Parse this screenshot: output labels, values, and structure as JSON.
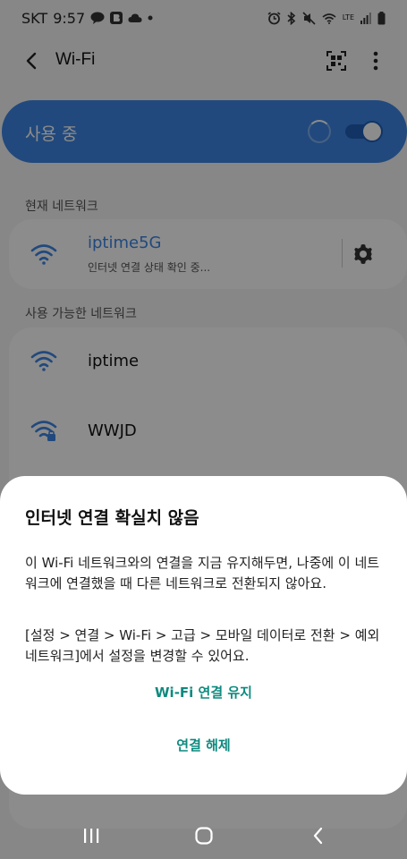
{
  "status_bar": {
    "carrier": "SKT",
    "time": "9:57",
    "network_type": "LTE",
    "icons": [
      "talk-icon",
      "b-app-icon",
      "cloud-icon",
      "dot-icon",
      "alarm-icon",
      "bluetooth-icon",
      "mute-icon",
      "wifi-status-icon",
      "signal-icon",
      "battery-icon"
    ]
  },
  "app_bar": {
    "title": "Wi-Fi",
    "icons": [
      "back-icon",
      "qr-scan-icon",
      "more-options-icon"
    ]
  },
  "wifi_toggle": {
    "label": "사용 중",
    "enabled": true
  },
  "current_network": {
    "section_label": "현재 네트워크",
    "name": "iptime5G",
    "status": "인터넷 연결 상태 확인 중..."
  },
  "available_networks": {
    "section_label": "사용 가능한 네트워크",
    "items": [
      {
        "name": "iptime",
        "secured": false
      },
      {
        "name": "WWJD",
        "secured": true
      }
    ]
  },
  "dialog": {
    "title": "인터넷 연결 확실치 않음",
    "body_1": "이 Wi-Fi 네트워크와의 연결을 지금 유지해두면, 나중에 이 네트워크에 연결했을 때 다른 네트워크로 전환되지 않아요.",
    "body_2": "[설정 > 연결 > Wi-Fi > 고급 > 모바일 데이터로 전환 > 예외 네트워크]에서 설정을 변경할 수 있어요.",
    "keep_label": "Wi-Fi 연결 유지",
    "disconnect_label": "연결 해제"
  },
  "colors": {
    "accent": "#3d85e4",
    "dialog_button": "#0e8a7f"
  }
}
